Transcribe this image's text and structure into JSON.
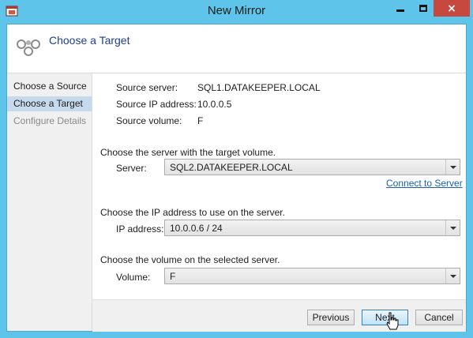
{
  "window": {
    "title": "New Mirror",
    "app_icon": "app-window-icon",
    "controls": {
      "minimize": "minimize-icon",
      "maximize": "maximize-icon",
      "close": "×"
    }
  },
  "header": {
    "icon": "mirror-nodes-icon",
    "title": "Choose a Target"
  },
  "nav": {
    "items": [
      {
        "label": "Choose a Source",
        "state": "normal"
      },
      {
        "label": "Choose a Target",
        "state": "selected"
      },
      {
        "label": "Configure Details",
        "state": "disabled"
      }
    ]
  },
  "source": {
    "server_label": "Source server:",
    "server_value": "SQL1.DATAKEEPER.LOCAL",
    "ip_label": "Source IP address:",
    "ip_value": "10.0.0.5",
    "volume_label": "Source volume:",
    "volume_value": "F"
  },
  "target_server": {
    "instruction": "Choose the server with the target volume.",
    "label": "Server:",
    "value": "SQL2.DATAKEEPER.LOCAL",
    "link": "Connect to Server"
  },
  "target_ip": {
    "instruction": "Choose the IP address to use on the server.",
    "label": "IP address:",
    "value": "10.0.0.6 / 24"
  },
  "target_volume": {
    "instruction": "Choose the volume on the selected server.",
    "label": "Volume:",
    "value": "F"
  },
  "buttons": {
    "previous": "Previous",
    "next": "Next",
    "cancel": "Cancel"
  },
  "colors": {
    "titlebar": "#5ec4ea",
    "close": "#c7483f",
    "header_title": "#1f3f8a",
    "nav_selected": "#c7d9ec",
    "link": "#1a5fb4"
  }
}
